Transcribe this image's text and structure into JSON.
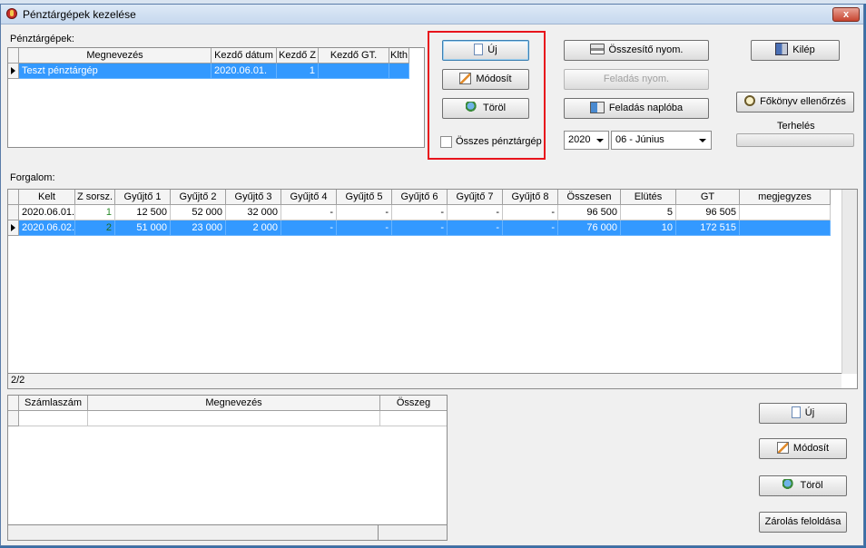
{
  "window": {
    "title": "Pénztárgépek kezelése",
    "close_label": "x"
  },
  "registers": {
    "section_label": "Pénztárgépek:",
    "columns": [
      "Megnevezés",
      "Kezdő dátum",
      "Kezdő Z",
      "Kezdő GT.",
      "Klth"
    ],
    "rows": [
      {
        "name": "Teszt pénztárgép",
        "start_date": "2020.06.01.",
        "start_z": "1",
        "start_gt": "",
        "klth": ""
      }
    ]
  },
  "register_actions": {
    "new_label": "Új",
    "edit_label": "Módosít",
    "delete_label": "Töröl",
    "all_registers_label": "Összes pénztárgép",
    "all_registers_checked": false
  },
  "report_actions": {
    "summary_print_label": "Összesítő nyom.",
    "posting_print_label": "Feladás nyom.",
    "posting_log_label": "Feladás naplóba",
    "year_value": "2020",
    "month_value": "06 - Június"
  },
  "side_actions": {
    "exit_label": "Kilép",
    "ledger_check_label": "Főkönyv ellenőrzés",
    "load_label": "Terhelés"
  },
  "turnover": {
    "section_label": "Forgalom:",
    "columns": [
      "Kelt",
      "Z sorsz.",
      "Gyűjtő 1",
      "Gyűjtő 2",
      "Gyűjtő 3",
      "Gyűjtő 4",
      "Gyűjtő 5",
      "Gyűjtő 6",
      "Gyűjtő 7",
      "Gyűjtő 8",
      "Összesen",
      "Elütés",
      "GT",
      "megjegyzes"
    ],
    "rows": [
      [
        "2020.06.01.",
        "1",
        "12 500",
        "52 000",
        "32 000",
        "-",
        "-",
        "-",
        "-",
        "-",
        "96 500",
        "5",
        "96 505",
        ""
      ],
      [
        "2020.06.02.",
        "2",
        "51 000",
        "23 000",
        "2 000",
        "-",
        "-",
        "-",
        "-",
        "-",
        "76 000",
        "10",
        "172 515",
        ""
      ]
    ],
    "record_counter": "2/2"
  },
  "accounts": {
    "columns": [
      "Számlaszám",
      "Megnevezés",
      "Összeg"
    ],
    "rows": [
      [
        "",
        "",
        ""
      ]
    ]
  },
  "account_actions": {
    "new_label": "Új",
    "edit_label": "Módosít",
    "delete_label": "Töröl",
    "unlock_label": "Zárolás feloldása"
  }
}
